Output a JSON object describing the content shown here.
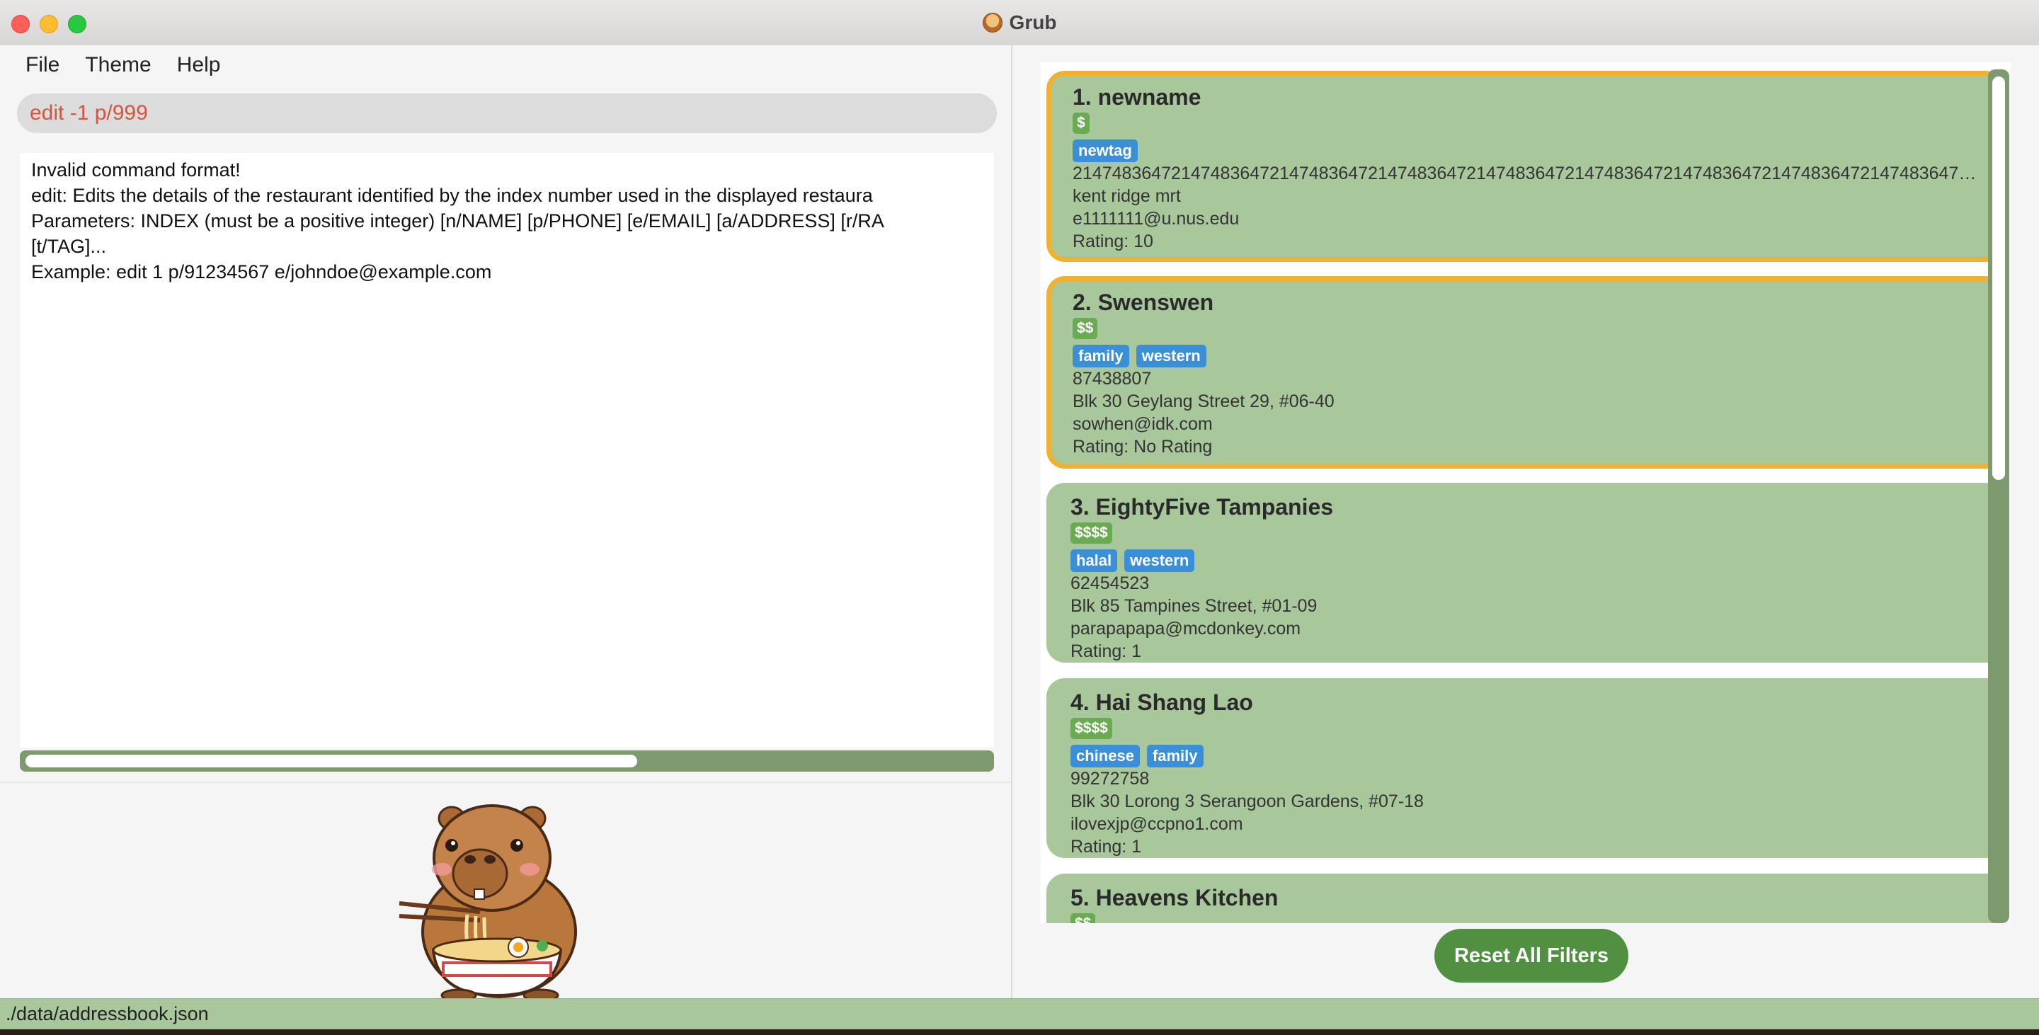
{
  "window": {
    "title": "Grub"
  },
  "menu": [
    "File",
    "Theme",
    "Help"
  ],
  "command_box": {
    "value": "edit -1 p/999"
  },
  "result_display": {
    "lines": [
      "Invalid command format!",
      "edit: Edits the details of the restaurant identified by the index number used in the displayed restaura",
      "Parameters: INDEX (must be a positive integer) [n/NAME] [p/PHONE] [e/EMAIL] [a/ADDRESS] [r/RA",
      "[t/TAG]...",
      "Example: edit 1 p/91234567 e/johndoe@example.com"
    ]
  },
  "restaurants": [
    {
      "name": "1. newname",
      "price": "$",
      "tags": [
        "newtag"
      ],
      "phone": "2147483647214748364721474836472147483647214748364721474836472147483647214748364721474836472147483647214748...",
      "address": "kent ridge mrt",
      "email": "e1111111@u.nus.edu",
      "rating": "Rating: 10"
    },
    {
      "name": "2. Swenswen",
      "price": "$$",
      "tags": [
        "family",
        "western"
      ],
      "phone": "87438807",
      "address": "Blk 30 Geylang Street 29, #06-40",
      "email": "sowhen@idk.com",
      "rating": "Rating: No Rating"
    },
    {
      "name": "3. EightyFive Tampanies",
      "price": "$$$$",
      "tags": [
        "halal",
        "western"
      ],
      "phone": "62454523",
      "address": "Blk 85 Tampines Street, #01-09",
      "email": "parapapapa@mcdonkey.com",
      "rating": "Rating: 1"
    },
    {
      "name": "4. Hai Shang Lao",
      "price": "$$$$",
      "tags": [
        "chinese",
        "family"
      ],
      "phone": "99272758",
      "address": "Blk 30 Lorong 3 Serangoon Gardens, #07-18",
      "email": "ilovexjp@ccpno1.com",
      "rating": "Rating: 1"
    },
    {
      "name": "5. Heavens Kitchen",
      "price": "$$"
    }
  ],
  "reset_button": "Reset All Filters",
  "status": {
    "path": "./data/addressbook.json"
  },
  "colors": {
    "card_bg": "#a8c89c",
    "selected_border": "#f0b131",
    "price_badge": "#6aaa52",
    "tag": "#3b8ed8",
    "scrollbar": "#7c9a6e",
    "reset_button": "#509040",
    "command_text": "#d5553f"
  },
  "icons": {
    "app": "hamburger-icon",
    "mascot": "capybara-eating-ramen-illustration"
  }
}
